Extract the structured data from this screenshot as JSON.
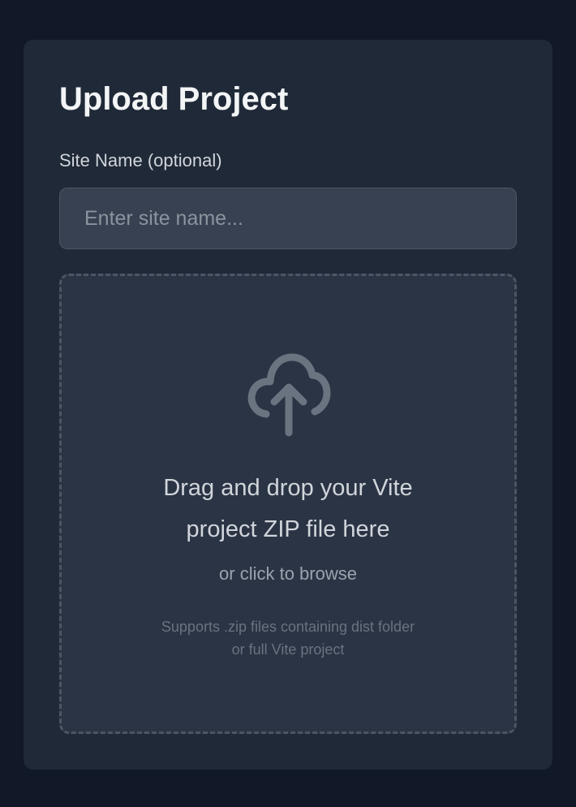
{
  "upload": {
    "title": "Upload Project",
    "site_name_label": "Site Name (optional)",
    "site_name_placeholder": "Enter site name...",
    "site_name_value": "",
    "dropzone": {
      "icon": "cloud-upload-icon",
      "primary_line1": "Drag and drop your Vite",
      "primary_line2": "project ZIP file here",
      "browse_text": "or click to browse",
      "note_line1": "Supports .zip files containing dist folder",
      "note_line2": "or full Vite project"
    }
  },
  "colors": {
    "page_bg": "#111827",
    "card_bg": "#1f2937",
    "input_bg": "#374151",
    "dropzone_bg": "#2a3444",
    "border": "#4b5563",
    "icon": "#6b7280"
  }
}
